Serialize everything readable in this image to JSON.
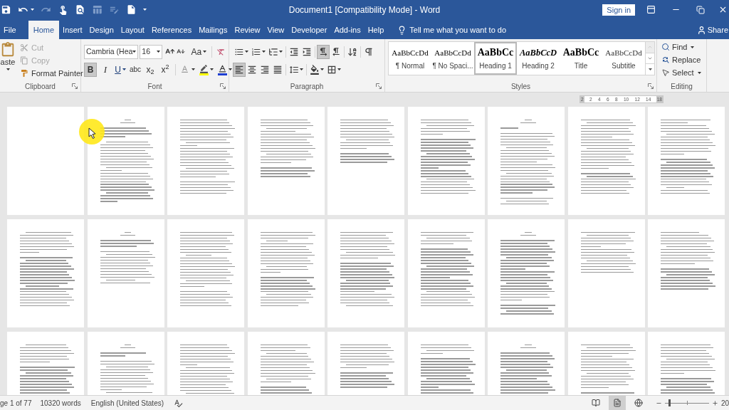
{
  "title_bar": {
    "quick_access": [
      {
        "kind": "save",
        "disabled": false
      },
      {
        "kind": "undo",
        "disabled": false
      },
      {
        "kind": "redo",
        "disabled": true
      },
      {
        "kind": "touch",
        "disabled": false
      },
      {
        "kind": "preview",
        "disabled": false
      },
      {
        "kind": "table",
        "disabled": true
      },
      {
        "kind": "note",
        "disabled": true
      },
      {
        "kind": "new",
        "disabled": false
      },
      {
        "kind": "customize"
      }
    ],
    "title": "Document1 [Compatibility Mode] - Word",
    "sign_in": "Sign in"
  },
  "tabs": [
    {
      "label": "File",
      "selected": false
    },
    {
      "label": "Home",
      "selected": true
    },
    {
      "label": "Insert",
      "selected": false
    },
    {
      "label": "Design",
      "selected": false
    },
    {
      "label": "Layout",
      "selected": false
    },
    {
      "label": "References",
      "selected": false
    },
    {
      "label": "Mailings",
      "selected": false
    },
    {
      "label": "Review",
      "selected": false
    },
    {
      "label": "View",
      "selected": false
    },
    {
      "label": "Developer",
      "selected": false
    },
    {
      "label": "Add-ins",
      "selected": false
    },
    {
      "label": "Help",
      "selected": false
    }
  ],
  "tell_me": {
    "placeholder": "Tell me what you want to do"
  },
  "share": "Share",
  "ribbon": {
    "clipboard": {
      "label": "Clipboard",
      "paste": "aste",
      "items": [
        {
          "kind": "cut",
          "label": "Cut",
          "disabled": true
        },
        {
          "kind": "copy",
          "label": "Copy",
          "disabled": true
        },
        {
          "kind": "painter",
          "label": "Format Painter",
          "disabled": false
        }
      ]
    },
    "font": {
      "label": "Font",
      "font_name": "Cambria (Hea",
      "font_size": "16",
      "change_case": "Aa",
      "toggles": [
        {
          "kind": "bold",
          "text": "B",
          "selected": true
        },
        {
          "kind": "italic",
          "text": "I",
          "selected": false
        },
        {
          "kind": "underline",
          "text": "U",
          "selected": false
        },
        {
          "kind": "strike",
          "text": "abc",
          "selected": false
        },
        {
          "kind": "subscript",
          "text": "x$_{2}$",
          "selected": false
        },
        {
          "kind": "superscript",
          "text": "x$^{2}$",
          "selected": false
        }
      ]
    },
    "paragraph": {
      "label": "Paragraph",
      "row1": [
        {
          "kind": "bullets"
        },
        {
          "kind": "numbering"
        },
        {
          "kind": "multilevel"
        },
        {
          "kind": "outdent"
        },
        {
          "kind": "indent"
        },
        {
          "kind": "ltr",
          "selected": true
        },
        {
          "kind": "rtl",
          "selected": false
        },
        {
          "kind": "sort"
        },
        {
          "kind": "pilcrow",
          "selected": false
        }
      ],
      "row2": [
        {
          "kind": "left",
          "selected": true
        },
        {
          "kind": "center",
          "selected": false
        },
        {
          "kind": "right",
          "selected": false
        },
        {
          "kind": "justify",
          "selected": false
        },
        {
          "kind": "spacing"
        },
        {
          "kind": "shading"
        },
        {
          "kind": "borders"
        }
      ]
    },
    "styles": {
      "label": "Styles",
      "items": [
        {
          "kind": "normal",
          "preview": "AaBbCcDd",
          "name": "¶ Normal",
          "selected": false
        },
        {
          "kind": "plain",
          "preview": "AaBbCcDd",
          "name": "¶ No Spaci...",
          "selected": false
        },
        {
          "kind": "heading1",
          "preview": "AaBbCc",
          "name": "Heading 1",
          "selected": true
        },
        {
          "kind": "heading2",
          "preview": "AaBbCcD",
          "name": "Heading 2",
          "selected": false
        },
        {
          "kind": "title",
          "preview": "AaBbCc",
          "name": "Title",
          "selected": false
        },
        {
          "kind": "subtitle",
          "preview": "AaBbCcDd",
          "name": "Subtitle",
          "selected": false
        }
      ]
    },
    "editing": {
      "label": "Editing",
      "items": [
        {
          "kind": "find",
          "label": "Find"
        },
        {
          "kind": "replace",
          "label": "Replace"
        },
        {
          "kind": "select",
          "label": "Select"
        }
      ]
    }
  },
  "ruler": {
    "labels": [
      "2",
      "2",
      "4",
      "6",
      "8",
      "10",
      "12",
      "14",
      "18"
    ]
  },
  "status_bar": {
    "page": "ge 1 of 77",
    "words": "10320 words",
    "language": "English (United States)",
    "views": [
      {
        "kind": "read",
        "selected": false
      },
      {
        "kind": "print",
        "selected": true
      },
      {
        "kind": "web",
        "selected": false
      }
    ],
    "zoom": {
      "level": 0.1,
      "reading": "20"
    }
  }
}
